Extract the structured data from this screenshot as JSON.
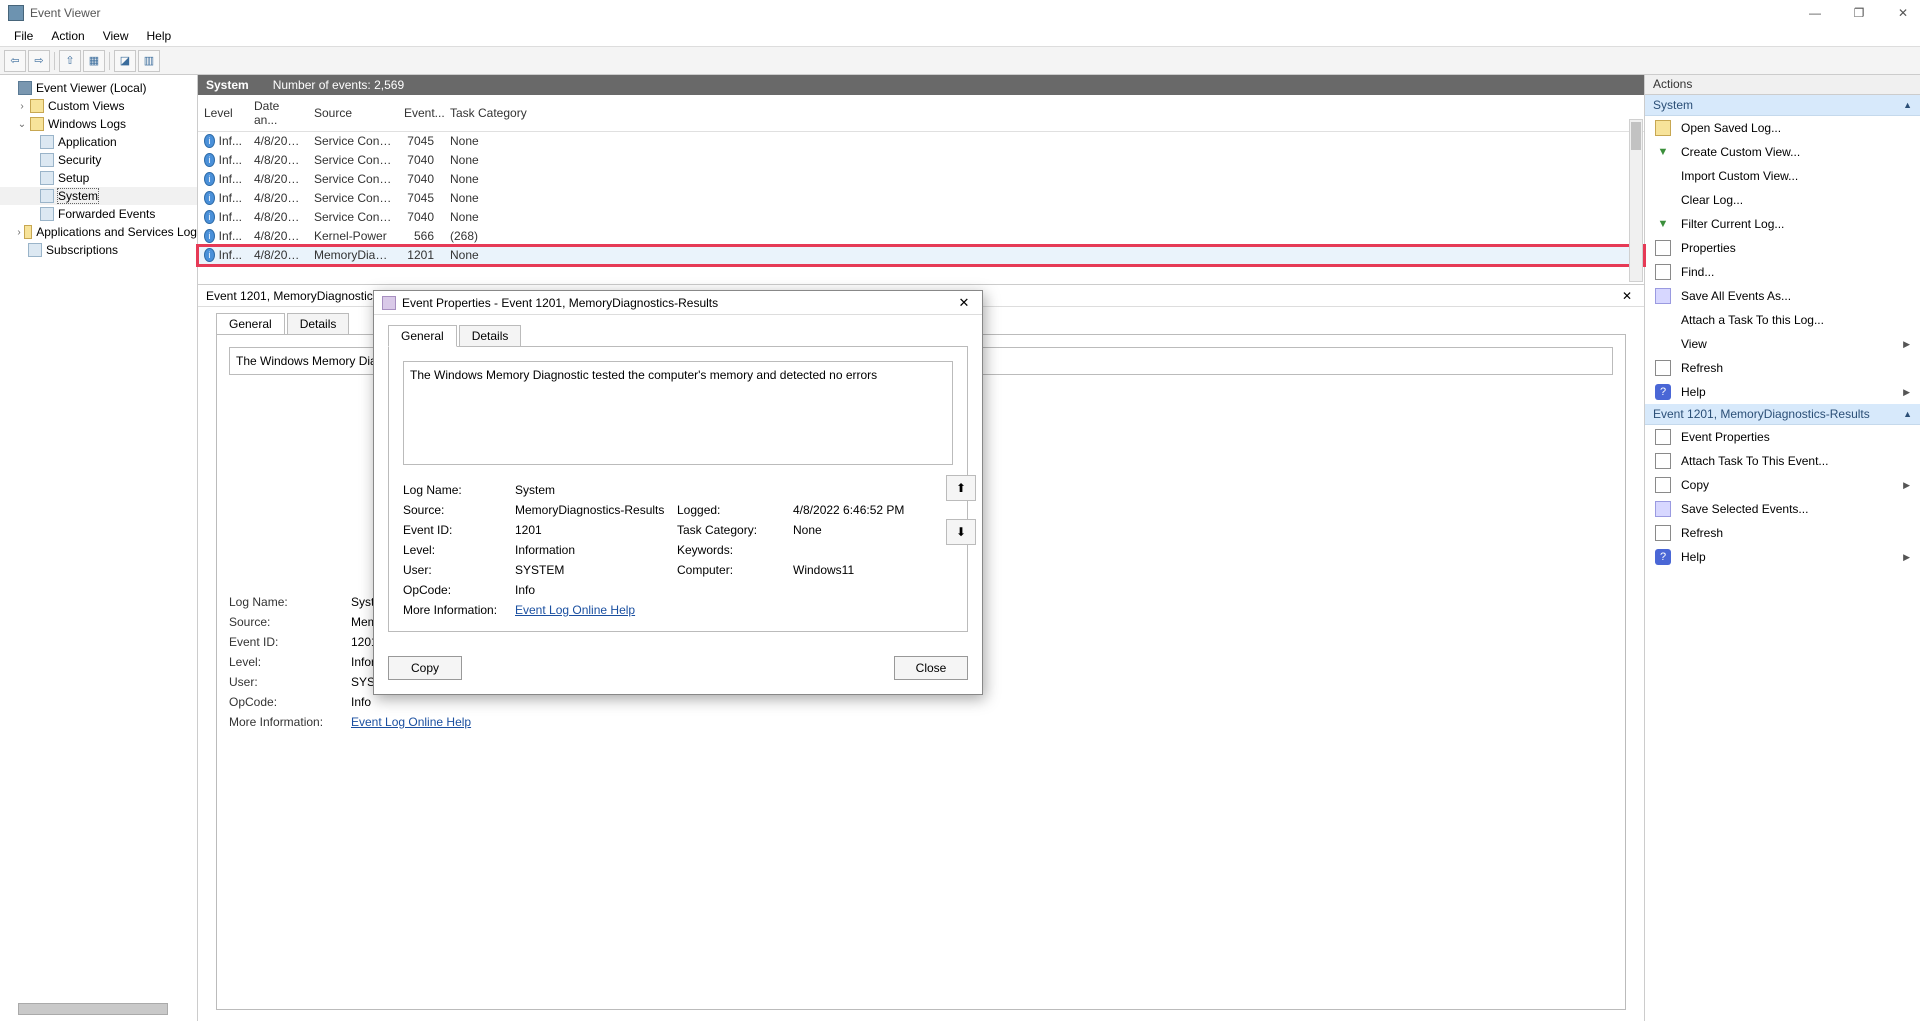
{
  "window": {
    "title": "Event Viewer",
    "controls": {
      "min": "—",
      "max": "❐",
      "close": "✕"
    }
  },
  "menu": [
    "File",
    "Action",
    "View",
    "Help"
  ],
  "toolbar": [
    "⇦",
    "⇨",
    "⇧",
    "▦",
    "◪",
    "▥"
  ],
  "tree": {
    "root": "Event Viewer (Local)",
    "customViews": "Custom Views",
    "windowsLogs": "Windows Logs",
    "logs": [
      "Application",
      "Security",
      "Setup",
      "System",
      "Forwarded Events"
    ],
    "appsSvc": "Applications and Services Log",
    "subs": "Subscriptions"
  },
  "centerHeader": {
    "section": "System",
    "count": "Number of events: 2,569"
  },
  "columns": {
    "level": "Level",
    "date": "Date an...",
    "source": "Source",
    "event": "Event...",
    "task": "Task Category"
  },
  "events": [
    {
      "level": "Inf...",
      "date": "4/8/202...",
      "source": "Service Contr...",
      "id": "7045",
      "task": "None",
      "hl": false
    },
    {
      "level": "Inf...",
      "date": "4/8/202...",
      "source": "Service Contr...",
      "id": "7040",
      "task": "None",
      "hl": false
    },
    {
      "level": "Inf...",
      "date": "4/8/202...",
      "source": "Service Contr...",
      "id": "7040",
      "task": "None",
      "hl": false
    },
    {
      "level": "Inf...",
      "date": "4/8/202...",
      "source": "Service Contr...",
      "id": "7045",
      "task": "None",
      "hl": false
    },
    {
      "level": "Inf...",
      "date": "4/8/202...",
      "source": "Service Contr...",
      "id": "7040",
      "task": "None",
      "hl": false
    },
    {
      "level": "Inf...",
      "date": "4/8/202...",
      "source": "Kernel-Power",
      "id": "566",
      "task": "(268)",
      "hl": false
    },
    {
      "level": "Inf...",
      "date": "4/8/202...",
      "source": "MemoryDiag...",
      "id": "1201",
      "task": "None",
      "hl": true
    }
  ],
  "preview": {
    "title": "Event 1201, MemoryDiagnostics-Results",
    "tabs": {
      "general": "General",
      "details": "Details"
    },
    "desc": "The Windows Memory Dia",
    "labels": {
      "logName": "Log Name:",
      "source": "Source:",
      "eventId": "Event ID:",
      "level": "Level:",
      "user": "User:",
      "opcode": "OpCode:",
      "more": "More Information:"
    },
    "values": {
      "logName": "System",
      "source": "Memor",
      "eventId": "1201",
      "level": "Informa",
      "user": "SYSTEM",
      "opcode": "Info",
      "link": "Event Log Online Help"
    }
  },
  "dialog": {
    "title": "Event Properties - Event 1201, MemoryDiagnostics-Results",
    "tabs": {
      "general": "General",
      "details": "Details"
    },
    "desc": "The Windows Memory Diagnostic tested the computer's memory and detected no errors",
    "labels": {
      "logName": "Log Name:",
      "source": "Source:",
      "logged": "Logged:",
      "eventId": "Event ID:",
      "taskCat": "Task Category:",
      "level": "Level:",
      "keywords": "Keywords:",
      "user": "User:",
      "computer": "Computer:",
      "opcode": "OpCode:",
      "more": "More Information:"
    },
    "values": {
      "logName": "System",
      "source": "MemoryDiagnostics-Results",
      "logged": "4/8/2022 6:46:52 PM",
      "eventId": "1201",
      "taskCat": "None",
      "level": "Information",
      "keywords": "",
      "user": "SYSTEM",
      "computer": "Windows11",
      "opcode": "Info",
      "link": "Event Log Online Help"
    },
    "buttons": {
      "copy": "Copy",
      "close": "Close",
      "up": "⬆",
      "down": "⬇"
    }
  },
  "actions": {
    "header": "Actions",
    "sectionSystem": "System",
    "systemItems": [
      {
        "label": "Open Saved Log...",
        "icon": "open"
      },
      {
        "label": "Create Custom View...",
        "icon": "funnel"
      },
      {
        "label": "Import Custom View...",
        "icon": ""
      },
      {
        "label": "Clear Log...",
        "icon": ""
      },
      {
        "label": "Filter Current Log...",
        "icon": "funnel"
      },
      {
        "label": "Properties",
        "icon": "square"
      },
      {
        "label": "Find...",
        "icon": "square"
      },
      {
        "label": "Save All Events As...",
        "icon": "disk"
      },
      {
        "label": "Attach a Task To this Log...",
        "icon": ""
      },
      {
        "label": "View",
        "icon": "",
        "arrow": true
      },
      {
        "label": "Refresh",
        "icon": "square"
      },
      {
        "label": "Help",
        "icon": "help",
        "arrow": true
      }
    ],
    "sectionEvent": "Event 1201, MemoryDiagnostics-Results",
    "eventItems": [
      {
        "label": "Event Properties",
        "icon": "square"
      },
      {
        "label": "Attach Task To This Event...",
        "icon": "square"
      },
      {
        "label": "Copy",
        "icon": "square",
        "arrow": true
      },
      {
        "label": "Save Selected Events...",
        "icon": "disk"
      },
      {
        "label": "Refresh",
        "icon": "square"
      },
      {
        "label": "Help",
        "icon": "help",
        "arrow": true
      }
    ]
  }
}
